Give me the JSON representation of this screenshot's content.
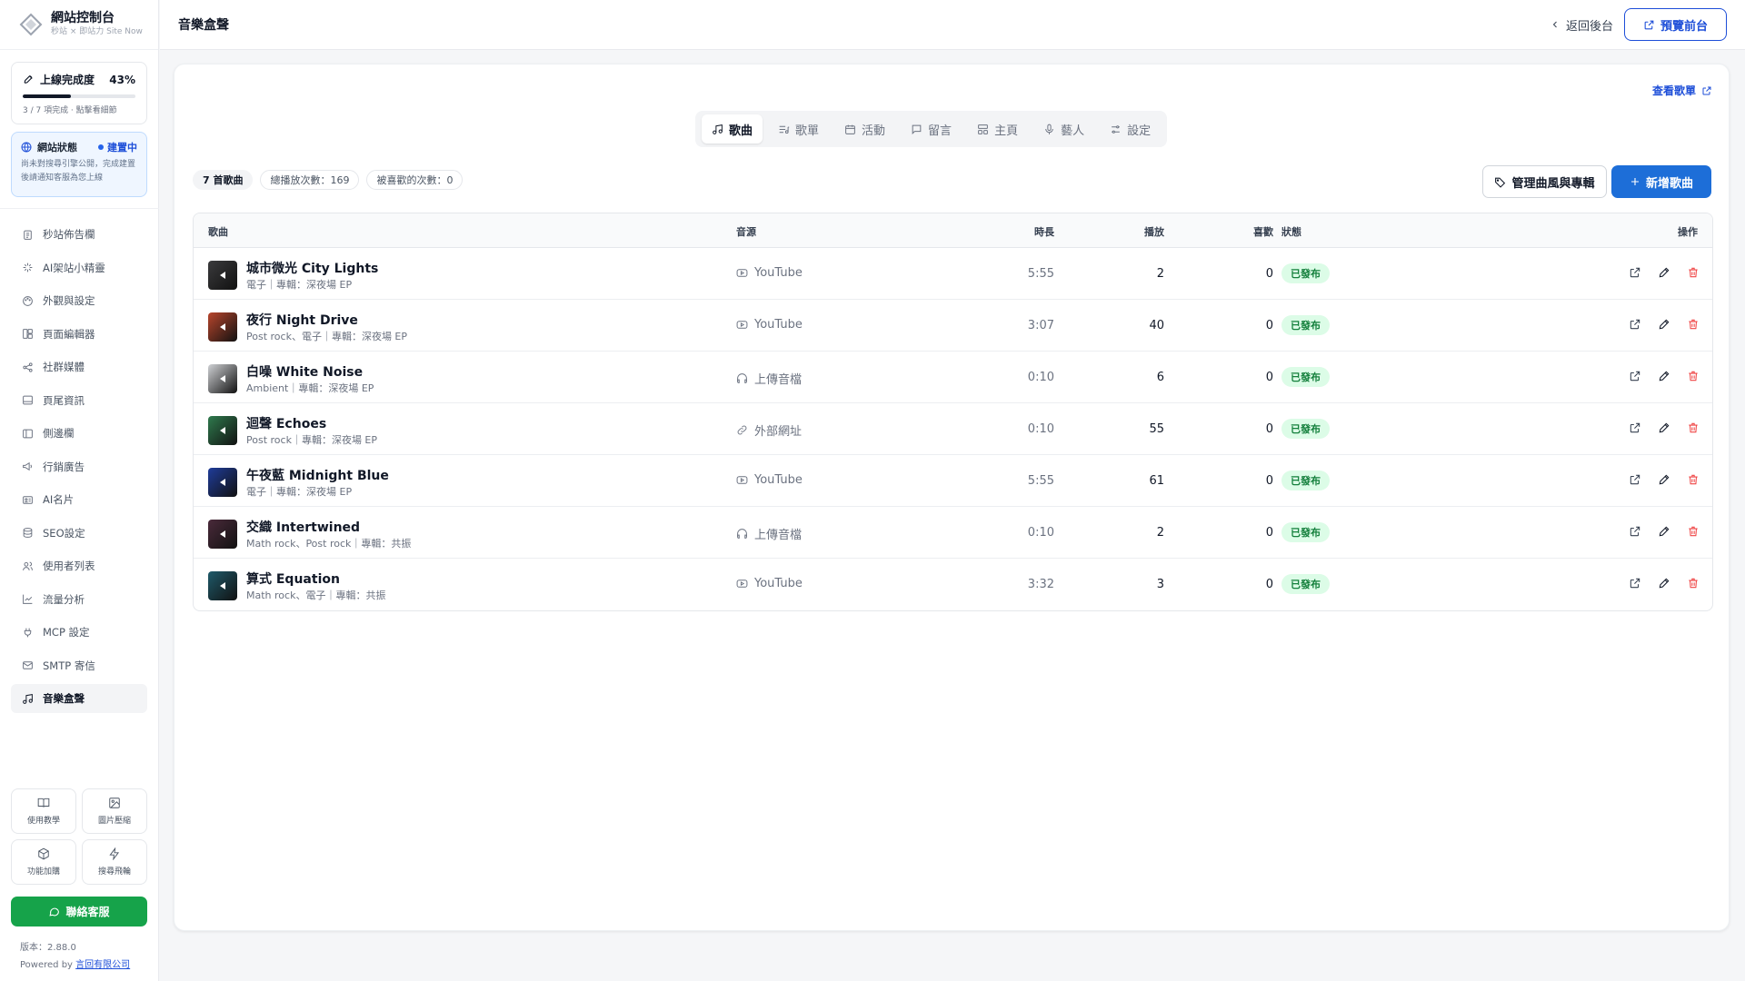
{
  "sidebar": {
    "brand_title": "網站控制台",
    "brand_sub": "秒站 × 即站力 Site Now",
    "progress": {
      "label": "上線完成度",
      "percent_text": "43%",
      "percent": 43,
      "note": "3 / 7 項完成 · 點擊看細節"
    },
    "status": {
      "label": "網站狀態",
      "state": "建置中",
      "note": "尚未對搜尋引擎公開，完成建置後請通知客服為您上線"
    },
    "items": [
      {
        "label": "秒站佈告欄",
        "icon": "clipboard-icon"
      },
      {
        "label": "AI架站小精靈",
        "icon": "sparkle-icon"
      },
      {
        "label": "外觀與設定",
        "icon": "palette-icon"
      },
      {
        "label": "頁面編輯器",
        "icon": "layout-icon"
      },
      {
        "label": "社群媒體",
        "icon": "share-icon"
      },
      {
        "label": "頁尾資訊",
        "icon": "footer-icon"
      },
      {
        "label": "側邊欄",
        "icon": "sidebar-icon"
      },
      {
        "label": "行銷廣告",
        "icon": "megaphone-icon"
      },
      {
        "label": "AI名片",
        "icon": "id-card-icon"
      },
      {
        "label": "SEO設定",
        "icon": "database-icon"
      },
      {
        "label": "使用者列表",
        "icon": "users-icon"
      },
      {
        "label": "流量分析",
        "icon": "chart-line-icon"
      },
      {
        "label": "MCP 設定",
        "icon": "plug-icon"
      },
      {
        "label": "SMTP 寄信",
        "icon": "mail-icon"
      },
      {
        "label": "音樂盒聲",
        "icon": "music-icon"
      }
    ],
    "tools": [
      {
        "label": "使用教學",
        "icon": "book-icon"
      },
      {
        "label": "圖片壓縮",
        "icon": "image-icon"
      },
      {
        "label": "功能加購",
        "icon": "package-icon"
      },
      {
        "label": "搜尋飛輪",
        "icon": "bolt-icon"
      }
    ],
    "contact_label": "聯絡客服",
    "version_text": "版本：2.88.0",
    "powered_by": "Powered by",
    "company": "言回有限公司"
  },
  "header": {
    "title": "音樂盒聲",
    "back_label": "返回後台",
    "preview_label": "預覽前台"
  },
  "main": {
    "view_playlist_label": "查看歌單",
    "tabs": [
      {
        "label": "歌曲",
        "icon": "music-icon"
      },
      {
        "label": "歌單",
        "icon": "list-music-icon"
      },
      {
        "label": "活動",
        "icon": "calendar-icon"
      },
      {
        "label": "留言",
        "icon": "message-icon"
      },
      {
        "label": "主頁",
        "icon": "home-layout-icon"
      },
      {
        "label": "藝人",
        "icon": "mic-icon"
      },
      {
        "label": "設定",
        "icon": "sliders-icon"
      }
    ],
    "stats": {
      "count": "7 首歌曲",
      "total_plays": "總播放次數：169",
      "total_likes": "被喜歡的次數：0"
    },
    "manage_label": "管理曲風與專輯",
    "add_label": "新增歌曲",
    "columns": {
      "song": "歌曲",
      "source": "音源",
      "duration": "時長",
      "plays": "播放",
      "likes": "喜歡",
      "status": "狀態",
      "actions": "操作"
    },
    "songs": [
      {
        "title": "城市微光 City Lights",
        "meta": "電子｜專輯：深夜場 EP",
        "source": "YouTube",
        "source_icon": "youtube-icon",
        "duration": "5:55",
        "plays": "2",
        "likes": "0",
        "status": "已發布",
        "cover": "#3a3a3c"
      },
      {
        "title": "夜行 Night Drive",
        "meta": "Post rock、電子｜專輯：深夜場 EP",
        "source": "YouTube",
        "source_icon": "youtube-icon",
        "duration": "3:07",
        "plays": "40",
        "likes": "0",
        "status": "已發布",
        "cover": "#b8452c"
      },
      {
        "title": "白噪 White Noise",
        "meta": "Ambient｜專輯：深夜場 EP",
        "source": "上傳音檔",
        "source_icon": "headphones-icon",
        "duration": "0:10",
        "plays": "6",
        "likes": "0",
        "status": "已發布",
        "cover": "#cfd1d4"
      },
      {
        "title": "迴聲 Echoes",
        "meta": "Post rock｜專輯：深夜場 EP",
        "source": "外部網址",
        "source_icon": "link-icon",
        "duration": "0:10",
        "plays": "55",
        "likes": "0",
        "status": "已發布",
        "cover": "#2f7a4d"
      },
      {
        "title": "午夜藍 Midnight Blue",
        "meta": "電子｜專輯：深夜場 EP",
        "source": "YouTube",
        "source_icon": "youtube-icon",
        "duration": "5:55",
        "plays": "61",
        "likes": "0",
        "status": "已發布",
        "cover": "#1f3c9a"
      },
      {
        "title": "交織 Intertwined",
        "meta": "Math rock、Post rock｜專輯：共振",
        "source": "上傳音檔",
        "source_icon": "headphones-icon",
        "duration": "0:10",
        "plays": "2",
        "likes": "0",
        "status": "已發布",
        "cover": "#4a2a3a"
      },
      {
        "title": "算式 Equation",
        "meta": "Math rock、電子｜專輯：共振",
        "source": "YouTube",
        "source_icon": "youtube-icon",
        "duration": "3:32",
        "plays": "3",
        "likes": "0",
        "status": "已發布",
        "cover": "#1f5a6a"
      }
    ]
  }
}
